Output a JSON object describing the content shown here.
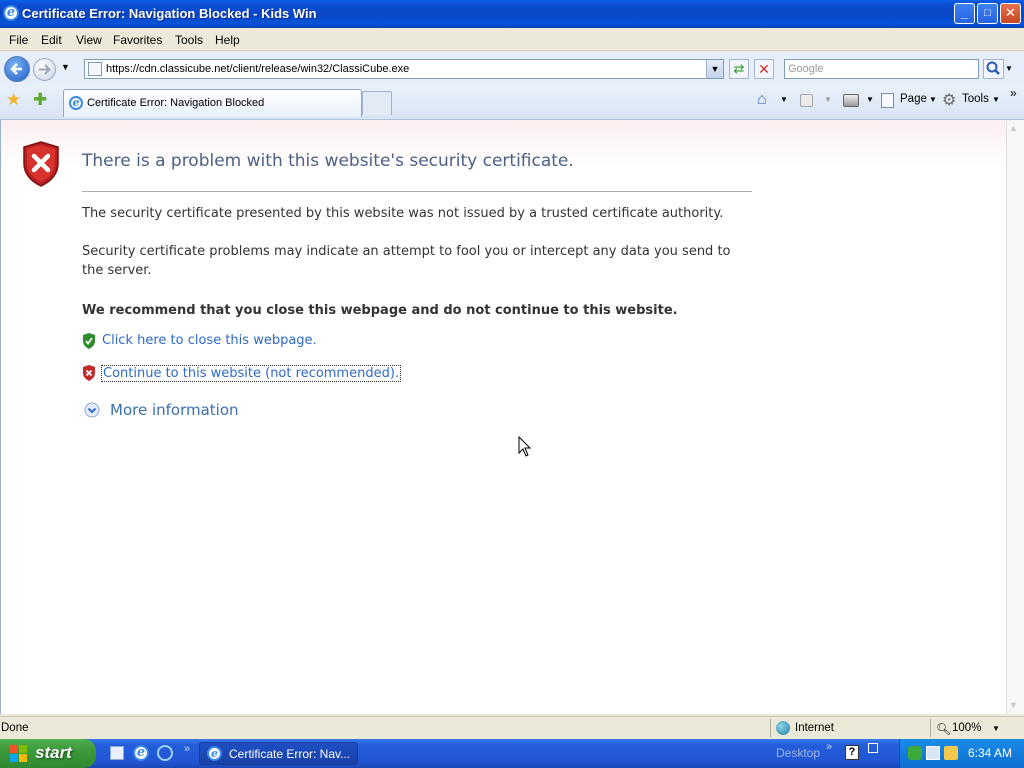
{
  "window": {
    "title": "Certificate Error: Navigation Blocked - Kids Win",
    "controls": {
      "minimize": "_",
      "maximize": "□",
      "close": "✕"
    }
  },
  "menu": [
    "File",
    "Edit",
    "View",
    "Favorites",
    "Tools",
    "Help"
  ],
  "address_bar": {
    "url": "https://cdn.classicube.net/client/release/win32/ClassiCube.exe"
  },
  "search": {
    "placeholder": "Google"
  },
  "tab": {
    "label": "Certificate Error: Navigation Blocked"
  },
  "commands": {
    "page": "Page",
    "tools": "Tools"
  },
  "content": {
    "heading": "There is a problem with this website's security certificate.",
    "para1": "The security certificate presented by this website was not issued by a trusted certificate authority.",
    "para2": "Security certificate problems may indicate an attempt to fool you or intercept any data you send to the server.",
    "recommend": "We recommend that you close this webpage and do not continue to this website.",
    "close_link": "Click here to close this webpage.",
    "continue_link": "Continue to this website (not recommended).",
    "more_info": "More information"
  },
  "status": {
    "text": "Done",
    "zone": "Internet",
    "zoom": "100%"
  },
  "taskbar": {
    "start": "start",
    "window_button": "Certificate Error: Nav...",
    "desktop": "Desktop",
    "time": "6:34 AM"
  },
  "colors": {
    "link": "#2E6ACB",
    "heading": "#4D6185",
    "xp_blue": "#245EDB",
    "start_green": "#3C9A3C"
  }
}
